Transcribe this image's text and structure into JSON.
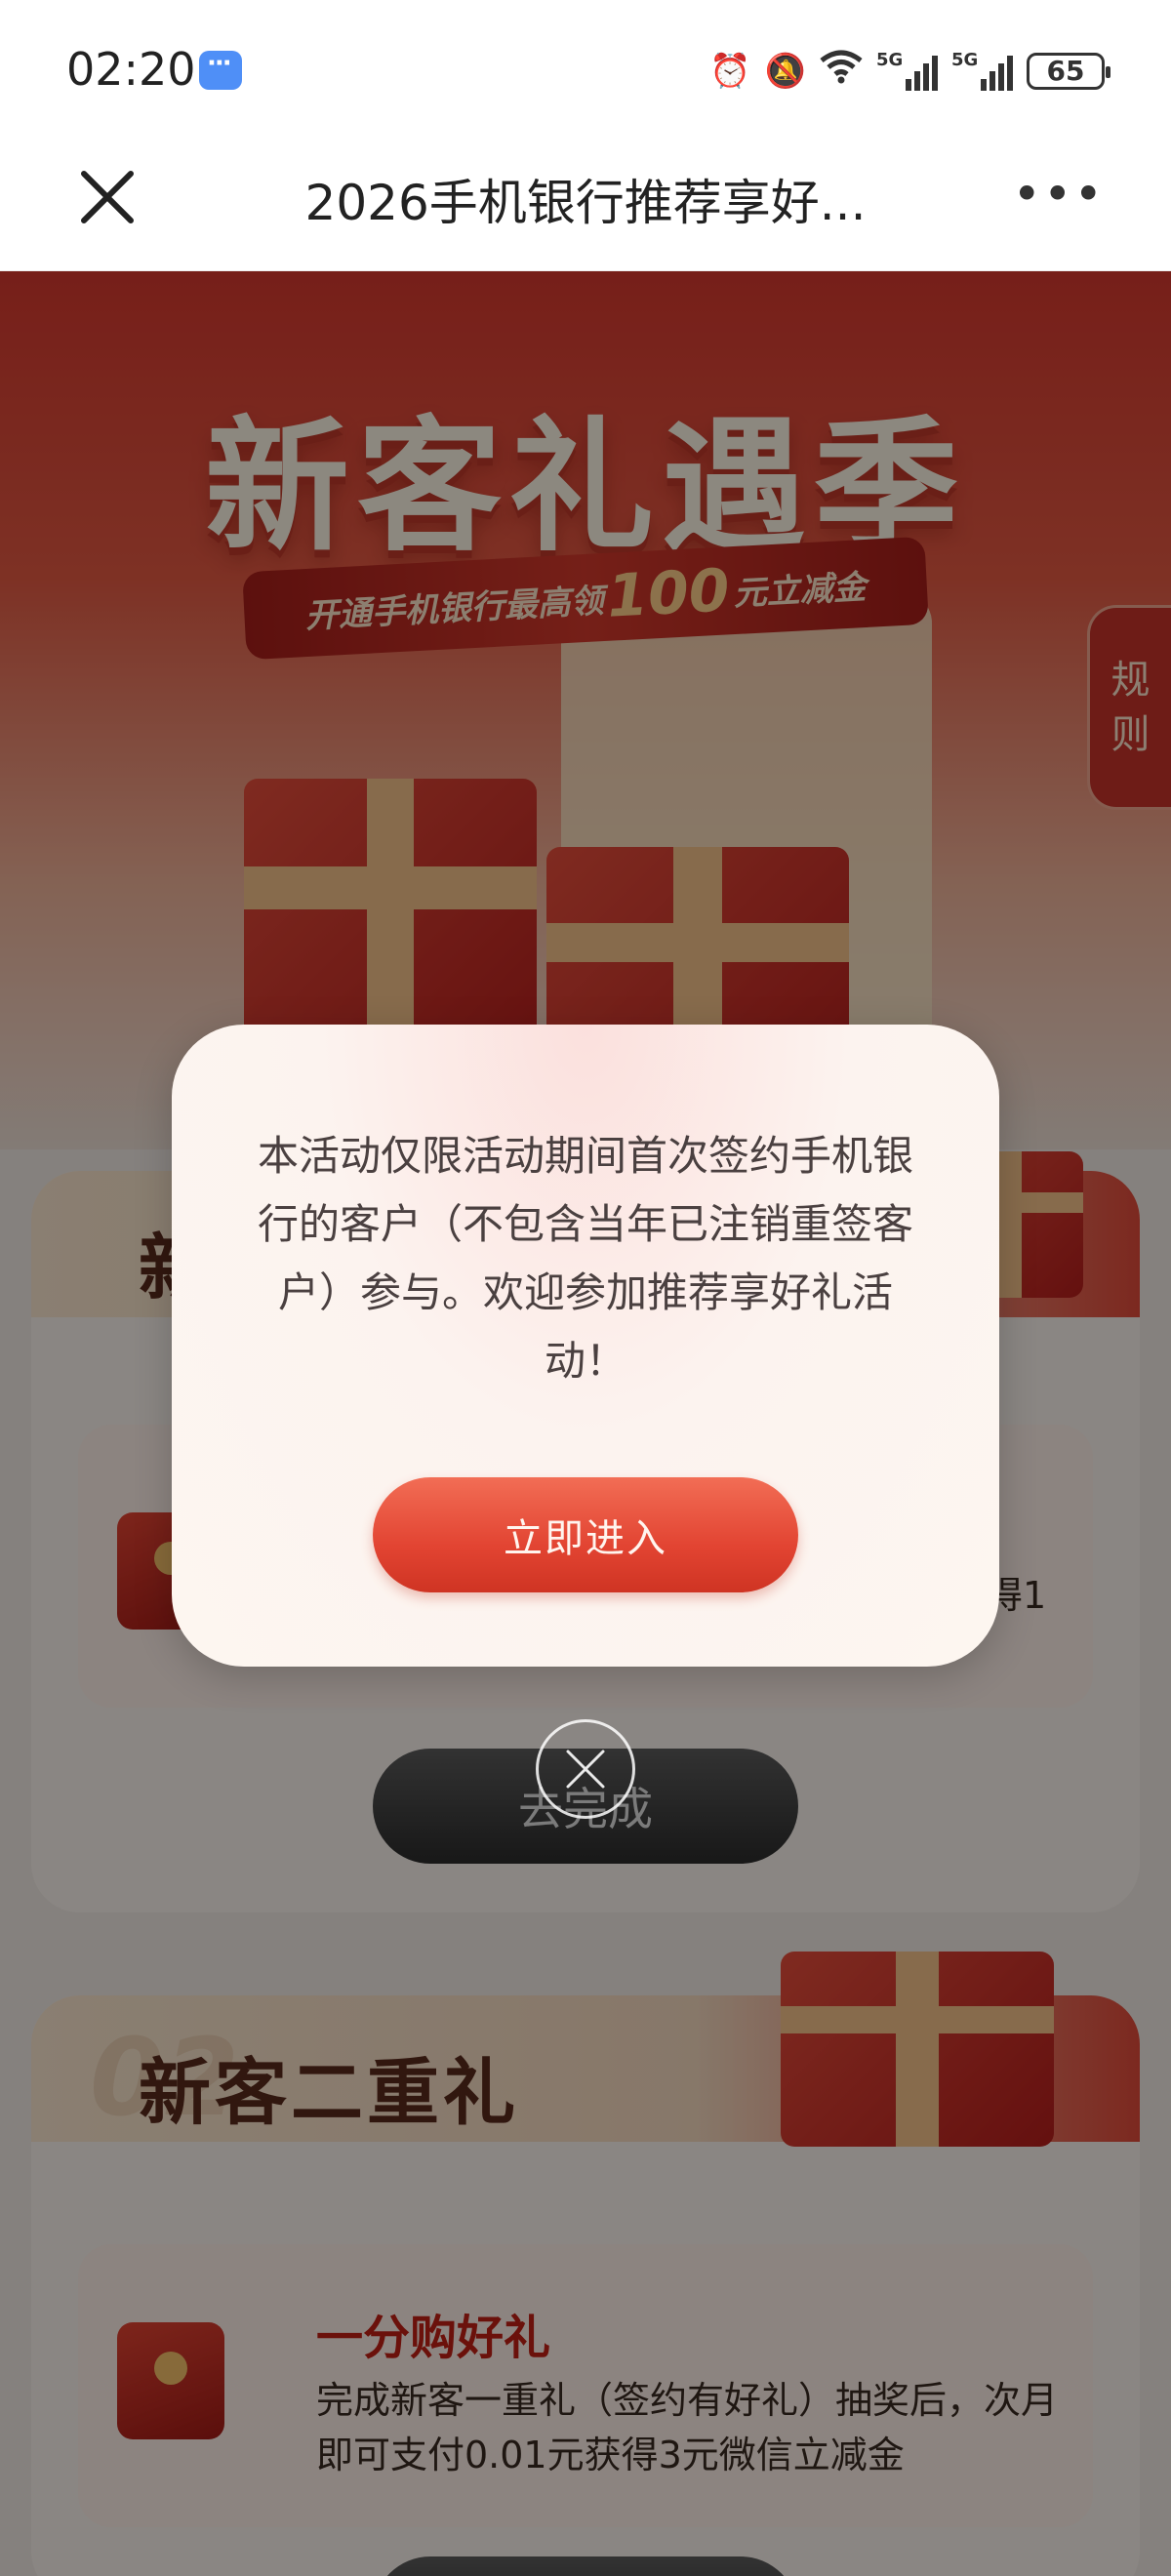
{
  "status_bar": {
    "time": "02:20",
    "signal_label_1": "5G",
    "signal_label_2": "5G",
    "battery": "65"
  },
  "title_bar": {
    "title": "2026手机银行推荐享好..."
  },
  "hero": {
    "title": "新客礼遇季",
    "ribbon_prefix": "开通手机银行最高领",
    "ribbon_amount": "100",
    "ribbon_suffix": "元立减金",
    "rules_char_1": "规",
    "rules_char_2": "则"
  },
  "section1": {
    "title": "新",
    "tail_text": "得1",
    "button": "去完成"
  },
  "section2": {
    "number": "02",
    "title": "新客二重礼",
    "card_title": "一分购好礼",
    "card_desc": "完成新客一重礼（签约有好礼）抽奖后，次月即可支付0.01元获得3元微信立减金"
  },
  "dialog": {
    "message": "本活动仅限活动期间首次签约手机银行的客户（不包含当年已注销重签客户）参与。欢迎参加推荐享好礼活动！",
    "enter_button": "立即进入"
  },
  "colors": {
    "accent_red": "#e24432",
    "overlay": "rgba(0,0,0,0.45)"
  }
}
